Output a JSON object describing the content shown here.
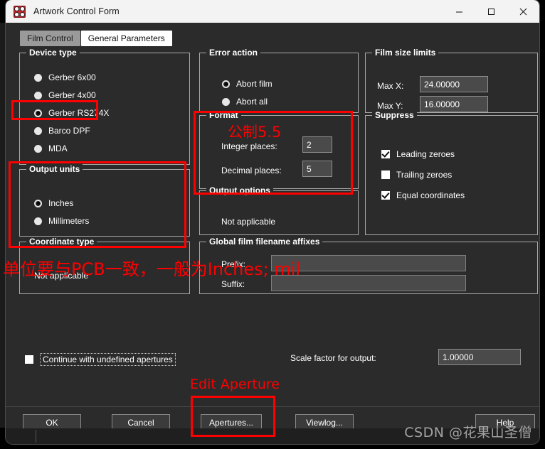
{
  "window": {
    "title": "Artwork Control Form",
    "icon": "artwork-app-icon",
    "controls": {
      "minimize": "minimize-icon",
      "maximize": "maximize-icon",
      "close": "close-icon"
    }
  },
  "tabs": [
    {
      "label": "Film Control",
      "active": false
    },
    {
      "label": "General Parameters",
      "active": true
    }
  ],
  "device_type": {
    "legend": "Device type",
    "options": [
      {
        "label": "Gerber 6x00",
        "selected": false
      },
      {
        "label": "Gerber 4x00",
        "selected": false
      },
      {
        "label": "Gerber RS274X",
        "selected": true
      },
      {
        "label": "Barco DPF",
        "selected": false
      },
      {
        "label": "MDA",
        "selected": false
      }
    ]
  },
  "output_units": {
    "legend": "Output units",
    "options": [
      {
        "label": "Inches",
        "selected": true
      },
      {
        "label": "Millimeters",
        "selected": false
      }
    ]
  },
  "coordinate_type": {
    "legend": "Coordinate type",
    "value": "Not applicable"
  },
  "error_action": {
    "legend": "Error action",
    "options": [
      {
        "label": "Abort film",
        "selected": true
      },
      {
        "label": "Abort all",
        "selected": false
      }
    ]
  },
  "format": {
    "legend": "Format",
    "integer_places_label": "Integer places:",
    "integer_places_value": "2",
    "decimal_places_label": "Decimal places:",
    "decimal_places_value": "5"
  },
  "output_options": {
    "legend": "Output options",
    "value": "Not applicable"
  },
  "global_affixes": {
    "legend": "Global film filename affixes",
    "prefix_label": "Prefix:",
    "prefix_value": "",
    "suffix_label": "Suffix:",
    "suffix_value": ""
  },
  "film_size_limits": {
    "legend": "Film size limits",
    "max_x_label": "Max X:",
    "max_x_value": "24.00000",
    "max_y_label": "Max Y:",
    "max_y_value": "16.00000"
  },
  "suppress": {
    "legend": "Suppress",
    "options": [
      {
        "label": "Leading zeroes",
        "checked": true
      },
      {
        "label": "Trailing zeroes",
        "checked": false
      },
      {
        "label": "Equal coordinates",
        "checked": true
      }
    ]
  },
  "bottom": {
    "continue_undefined_label": "Continue with undefined apertures",
    "continue_undefined_checked": false,
    "scale_factor_label": "Scale factor for output:",
    "scale_factor_value": "1.00000"
  },
  "buttons": {
    "ok": "OK",
    "cancel": "Cancel",
    "apertures": "Apertures...",
    "viewlog": "Viewlog...",
    "help": "Help"
  },
  "annotations": {
    "format_note": "公制5.5",
    "units_note": "单位要与PCB一致，一般为Inches; mil",
    "aperture_note": "Edit Aperture",
    "highlight_color": "#fe0000"
  },
  "watermark": "CSDN @花果山圣僧"
}
